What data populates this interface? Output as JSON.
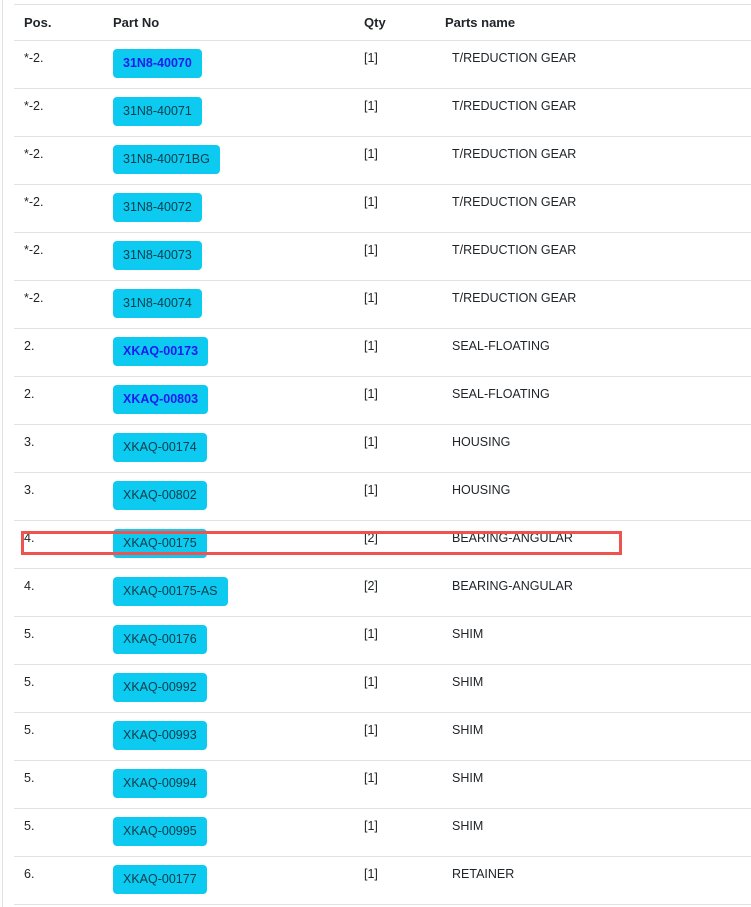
{
  "table": {
    "headers": {
      "pos": "Pos.",
      "part_no": "Part No",
      "qty": "Qty",
      "parts_name": "Parts name"
    },
    "rows": [
      {
        "pos": "*-2.",
        "part_no": "31N8-40070",
        "qty": "[1]",
        "name": "T/REDUCTION GEAR",
        "visited": true
      },
      {
        "pos": "*-2.",
        "part_no": "31N8-40071",
        "qty": "[1]",
        "name": "T/REDUCTION GEAR",
        "visited": false
      },
      {
        "pos": "*-2.",
        "part_no": "31N8-40071BG",
        "qty": "[1]",
        "name": "T/REDUCTION GEAR",
        "visited": false
      },
      {
        "pos": "*-2.",
        "part_no": "31N8-40072",
        "qty": "[1]",
        "name": "T/REDUCTION GEAR",
        "visited": false
      },
      {
        "pos": "*-2.",
        "part_no": "31N8-40073",
        "qty": "[1]",
        "name": "T/REDUCTION GEAR",
        "visited": false
      },
      {
        "pos": "*-2.",
        "part_no": "31N8-40074",
        "qty": "[1]",
        "name": "T/REDUCTION GEAR",
        "visited": false
      },
      {
        "pos": "2.",
        "part_no": "XKAQ-00173",
        "qty": "[1]",
        "name": "SEAL-FLOATING",
        "visited": true
      },
      {
        "pos": "2.",
        "part_no": "XKAQ-00803",
        "qty": "[1]",
        "name": "SEAL-FLOATING",
        "visited": true
      },
      {
        "pos": "3.",
        "part_no": "XKAQ-00174",
        "qty": "[1]",
        "name": "HOUSING",
        "visited": false
      },
      {
        "pos": "3.",
        "part_no": "XKAQ-00802",
        "qty": "[1]",
        "name": "HOUSING",
        "visited": false
      },
      {
        "pos": "4.",
        "part_no": "XKAQ-00175",
        "qty": "[2]",
        "name": "BEARING-ANGULAR",
        "visited": false
      },
      {
        "pos": "4.",
        "part_no": "XKAQ-00175-AS",
        "qty": "[2]",
        "name": "BEARING-ANGULAR",
        "visited": false
      },
      {
        "pos": "5.",
        "part_no": "XKAQ-00176",
        "qty": "[1]",
        "name": "SHIM",
        "visited": false
      },
      {
        "pos": "5.",
        "part_no": "XKAQ-00992",
        "qty": "[1]",
        "name": "SHIM",
        "visited": false
      },
      {
        "pos": "5.",
        "part_no": "XKAQ-00993",
        "qty": "[1]",
        "name": "SHIM",
        "visited": false
      },
      {
        "pos": "5.",
        "part_no": "XKAQ-00994",
        "qty": "[1]",
        "name": "SHIM",
        "visited": false
      },
      {
        "pos": "5.",
        "part_no": "XKAQ-00995",
        "qty": "[1]",
        "name": "SHIM",
        "visited": false
      },
      {
        "pos": "6.",
        "part_no": "XKAQ-00177",
        "qty": "[1]",
        "name": "RETAINER",
        "visited": false
      }
    ]
  },
  "colors": {
    "button_bg": "#0dcaf0",
    "visited_link": "#1b1bf0",
    "highlight": "#ef5350",
    "border": "#dee2e6"
  }
}
